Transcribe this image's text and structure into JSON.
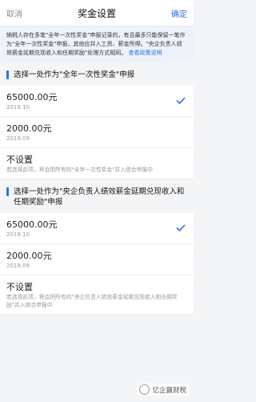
{
  "nav": {
    "cancel": "取消",
    "title": "奖金设置",
    "confirm": "确定"
  },
  "notice": {
    "text": "納税人存在多笔\"全年一次性奖金\"申报记录的，有且最多只能保留一笔作为\"全年一次性奖金\"申报，其他应并入工资、薪金所得。\"央企负责人绩效薪金延期兑现收入和任期奖励\"处理方式相同。",
    "link": "查看政策说明"
  },
  "section1": {
    "title": "选择一处作为\"全年一次性奖金\"申报",
    "options": [
      {
        "amount": "65000.00元",
        "date": "2019.10"
      },
      {
        "amount": "2000.00元",
        "date": "2019.09"
      }
    ],
    "none": {
      "label": "不设置",
      "note": "若选择此项，将会把所有的\"全年一次性奖金\"并入综合申报中"
    }
  },
  "section2": {
    "title": "选择一处作为\"央企负责人绩效薪金延期兑现收入和任期奖励\"申报",
    "options": [
      {
        "amount": "65000.00元",
        "date": "2019.10"
      },
      {
        "amount": "2000.00元",
        "date": "2019.09"
      }
    ],
    "none": {
      "label": "不设置",
      "note": "若选择此项，将会把所有的\"央企负责人绩效薪金延期兑现收入和任期奖励\"并入综合申报中"
    }
  },
  "watermark": {
    "text": "亿企赢财税"
  },
  "colors": {
    "accent": "#2b71e6"
  }
}
